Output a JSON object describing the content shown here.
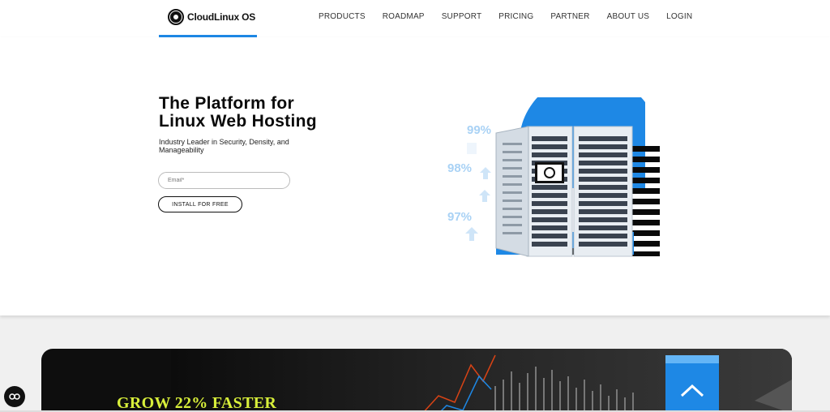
{
  "header": {
    "logo_text": "CloudLinux",
    "logo_suffix": "OS",
    "nav": [
      "PRODUCTS",
      "ROADMAP",
      "SUPPORT",
      "PRICING",
      "PARTNER",
      "ABOUT US",
      "LOGIN"
    ]
  },
  "hero": {
    "title_line1": "The Platform for",
    "title_line2": "Linux Web Hosting",
    "subtitle": "Industry Leader in Security, Density, and Manageability",
    "email_placeholder": "Email*",
    "install_label": "INSTALL FOR FREE",
    "percentages": [
      "99%",
      "98%",
      "97%"
    ]
  },
  "promo": {
    "title": "GROW 22% FASTER"
  },
  "colors": {
    "accent": "#1e88e5",
    "promo_text": "#d8ef3a",
    "percent": "#a9d2f5"
  }
}
